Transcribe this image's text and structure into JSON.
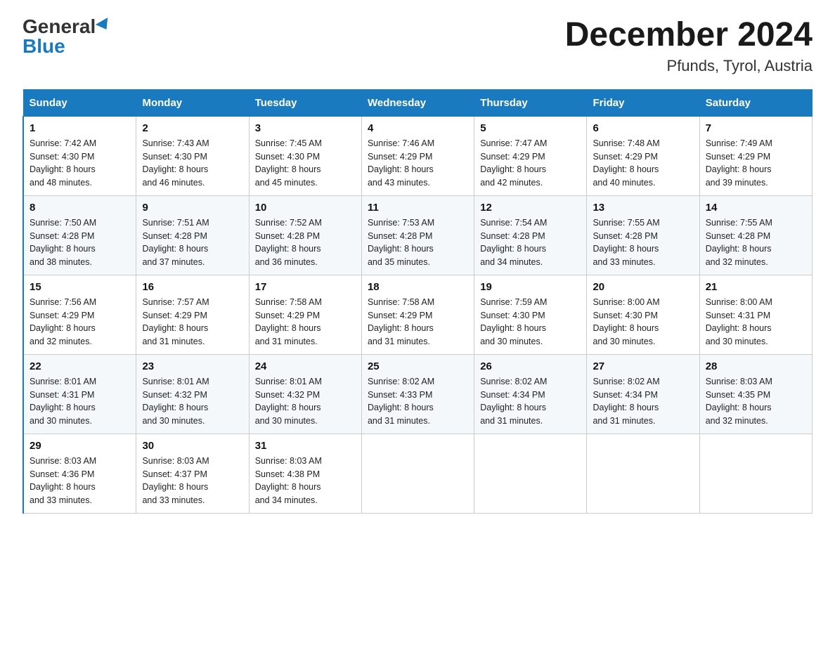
{
  "header": {
    "logo_general": "General",
    "logo_blue": "Blue",
    "month_title": "December 2024",
    "location": "Pfunds, Tyrol, Austria"
  },
  "days_of_week": [
    "Sunday",
    "Monday",
    "Tuesday",
    "Wednesday",
    "Thursday",
    "Friday",
    "Saturday"
  ],
  "weeks": [
    [
      {
        "day": "1",
        "sunrise": "7:42 AM",
        "sunset": "4:30 PM",
        "daylight": "8 hours and 48 minutes."
      },
      {
        "day": "2",
        "sunrise": "7:43 AM",
        "sunset": "4:30 PM",
        "daylight": "8 hours and 46 minutes."
      },
      {
        "day": "3",
        "sunrise": "7:45 AM",
        "sunset": "4:30 PM",
        "daylight": "8 hours and 45 minutes."
      },
      {
        "day": "4",
        "sunrise": "7:46 AM",
        "sunset": "4:29 PM",
        "daylight": "8 hours and 43 minutes."
      },
      {
        "day": "5",
        "sunrise": "7:47 AM",
        "sunset": "4:29 PM",
        "daylight": "8 hours and 42 minutes."
      },
      {
        "day": "6",
        "sunrise": "7:48 AM",
        "sunset": "4:29 PM",
        "daylight": "8 hours and 40 minutes."
      },
      {
        "day": "7",
        "sunrise": "7:49 AM",
        "sunset": "4:29 PM",
        "daylight": "8 hours and 39 minutes."
      }
    ],
    [
      {
        "day": "8",
        "sunrise": "7:50 AM",
        "sunset": "4:28 PM",
        "daylight": "8 hours and 38 minutes."
      },
      {
        "day": "9",
        "sunrise": "7:51 AM",
        "sunset": "4:28 PM",
        "daylight": "8 hours and 37 minutes."
      },
      {
        "day": "10",
        "sunrise": "7:52 AM",
        "sunset": "4:28 PM",
        "daylight": "8 hours and 36 minutes."
      },
      {
        "day": "11",
        "sunrise": "7:53 AM",
        "sunset": "4:28 PM",
        "daylight": "8 hours and 35 minutes."
      },
      {
        "day": "12",
        "sunrise": "7:54 AM",
        "sunset": "4:28 PM",
        "daylight": "8 hours and 34 minutes."
      },
      {
        "day": "13",
        "sunrise": "7:55 AM",
        "sunset": "4:28 PM",
        "daylight": "8 hours and 33 minutes."
      },
      {
        "day": "14",
        "sunrise": "7:55 AM",
        "sunset": "4:28 PM",
        "daylight": "8 hours and 32 minutes."
      }
    ],
    [
      {
        "day": "15",
        "sunrise": "7:56 AM",
        "sunset": "4:29 PM",
        "daylight": "8 hours and 32 minutes."
      },
      {
        "day": "16",
        "sunrise": "7:57 AM",
        "sunset": "4:29 PM",
        "daylight": "8 hours and 31 minutes."
      },
      {
        "day": "17",
        "sunrise": "7:58 AM",
        "sunset": "4:29 PM",
        "daylight": "8 hours and 31 minutes."
      },
      {
        "day": "18",
        "sunrise": "7:58 AM",
        "sunset": "4:29 PM",
        "daylight": "8 hours and 31 minutes."
      },
      {
        "day": "19",
        "sunrise": "7:59 AM",
        "sunset": "4:30 PM",
        "daylight": "8 hours and 30 minutes."
      },
      {
        "day": "20",
        "sunrise": "8:00 AM",
        "sunset": "4:30 PM",
        "daylight": "8 hours and 30 minutes."
      },
      {
        "day": "21",
        "sunrise": "8:00 AM",
        "sunset": "4:31 PM",
        "daylight": "8 hours and 30 minutes."
      }
    ],
    [
      {
        "day": "22",
        "sunrise": "8:01 AM",
        "sunset": "4:31 PM",
        "daylight": "8 hours and 30 minutes."
      },
      {
        "day": "23",
        "sunrise": "8:01 AM",
        "sunset": "4:32 PM",
        "daylight": "8 hours and 30 minutes."
      },
      {
        "day": "24",
        "sunrise": "8:01 AM",
        "sunset": "4:32 PM",
        "daylight": "8 hours and 30 minutes."
      },
      {
        "day": "25",
        "sunrise": "8:02 AM",
        "sunset": "4:33 PM",
        "daylight": "8 hours and 31 minutes."
      },
      {
        "day": "26",
        "sunrise": "8:02 AM",
        "sunset": "4:34 PM",
        "daylight": "8 hours and 31 minutes."
      },
      {
        "day": "27",
        "sunrise": "8:02 AM",
        "sunset": "4:34 PM",
        "daylight": "8 hours and 31 minutes."
      },
      {
        "day": "28",
        "sunrise": "8:03 AM",
        "sunset": "4:35 PM",
        "daylight": "8 hours and 32 minutes."
      }
    ],
    [
      {
        "day": "29",
        "sunrise": "8:03 AM",
        "sunset": "4:36 PM",
        "daylight": "8 hours and 33 minutes."
      },
      {
        "day": "30",
        "sunrise": "8:03 AM",
        "sunset": "4:37 PM",
        "daylight": "8 hours and 33 minutes."
      },
      {
        "day": "31",
        "sunrise": "8:03 AM",
        "sunset": "4:38 PM",
        "daylight": "8 hours and 34 minutes."
      },
      null,
      null,
      null,
      null
    ]
  ],
  "labels": {
    "sunrise": "Sunrise:",
    "sunset": "Sunset:",
    "daylight": "Daylight:"
  }
}
